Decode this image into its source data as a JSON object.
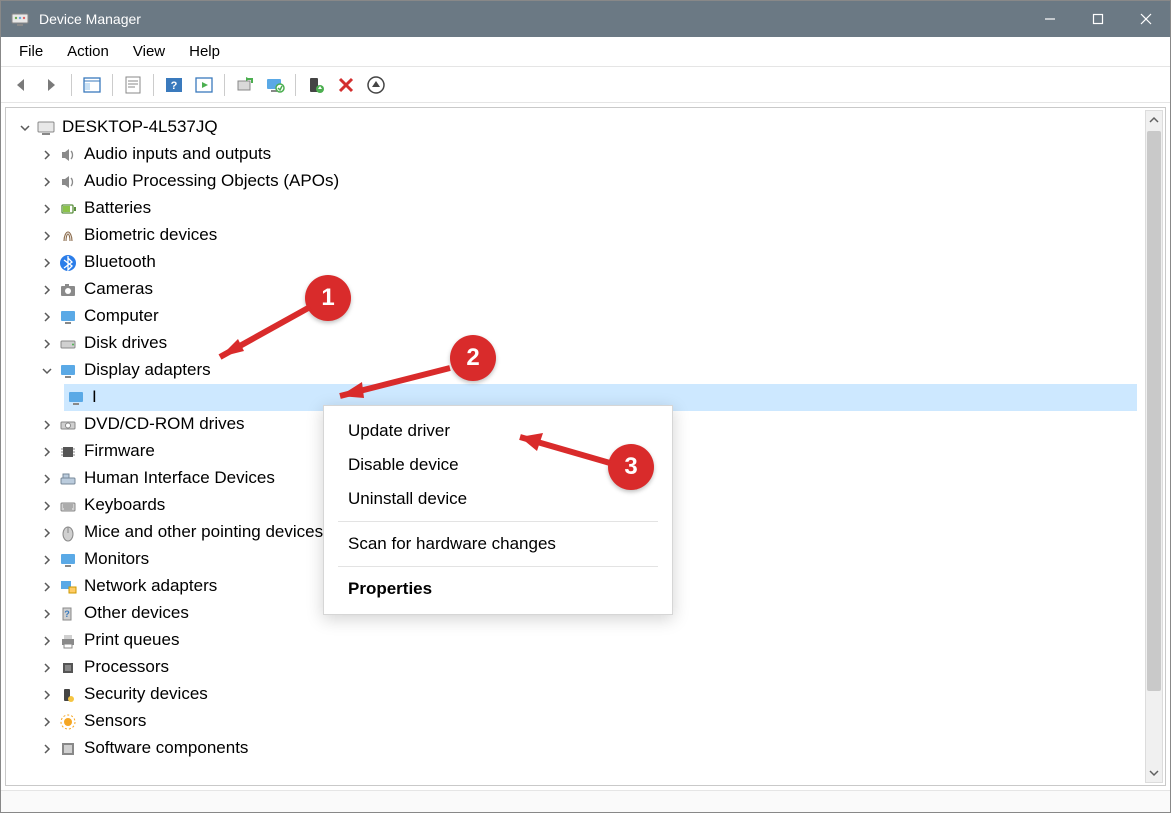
{
  "window": {
    "title": "Device Manager"
  },
  "menu": {
    "file": "File",
    "action": "Action",
    "view": "View",
    "help": "Help"
  },
  "tree": {
    "root": "DESKTOP-4L537JQ",
    "items": [
      "Audio inputs and outputs",
      "Audio Processing Objects (APOs)",
      "Batteries",
      "Biometric devices",
      "Bluetooth",
      "Cameras",
      "Computer",
      "Disk drives",
      "Display adapters",
      "DVD/CD-ROM drives",
      "Firmware",
      "Human Interface Devices",
      "Keyboards",
      "Mice and other pointing devices",
      "Monitors",
      "Network adapters",
      "Other devices",
      "Print queues",
      "Processors",
      "Security devices",
      "Sensors",
      "Software components"
    ],
    "selected_child": "I"
  },
  "context_menu": {
    "update": "Update driver",
    "disable": "Disable device",
    "uninstall": "Uninstall device",
    "scan": "Scan for hardware changes",
    "properties": "Properties"
  },
  "callouts": {
    "c1": "1",
    "c2": "2",
    "c3": "3"
  }
}
